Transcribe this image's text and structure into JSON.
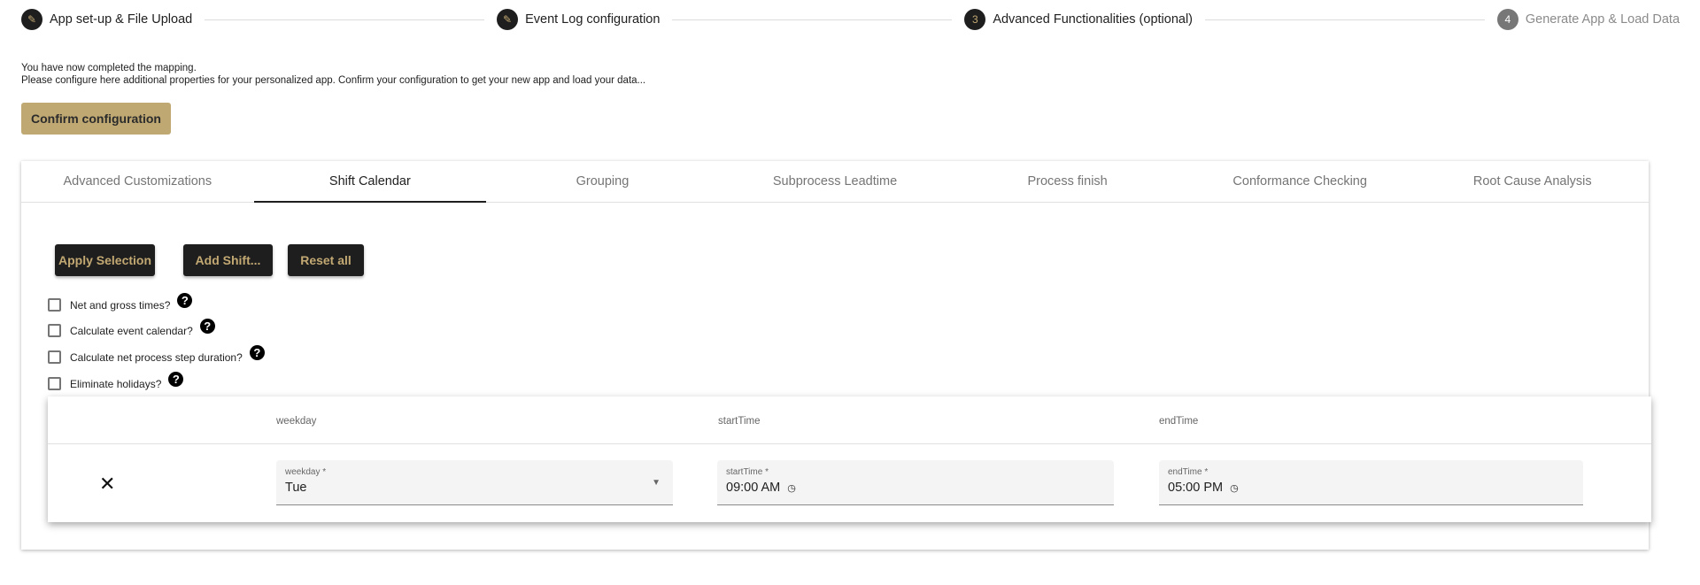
{
  "stepper": {
    "steps": [
      {
        "label": "App set-up & File Upload",
        "icon": "pencil-icon"
      },
      {
        "label": "Event Log configuration",
        "icon": "pencil-icon"
      },
      {
        "number": "3",
        "label": "Advanced Functionalities (optional)"
      },
      {
        "number": "4",
        "label": "Generate App & Load Data"
      }
    ]
  },
  "intro": {
    "line1": "You have now completed the mapping.",
    "line2": "Please configure here additional properties for your personalized app. Confirm your configuration to get your new app and load your data..."
  },
  "confirm_label": "Confirm configuration",
  "tabs": [
    "Advanced Customizations",
    "Shift Calendar",
    "Grouping",
    "Subprocess Leadtime",
    "Process finish",
    "Conformance Checking",
    "Root Cause Analysis"
  ],
  "active_tab": "Shift Calendar",
  "actions": {
    "apply": "Apply Selection",
    "add_shift": "Add Shift...",
    "reset": "Reset all"
  },
  "options": [
    {
      "label": "Net and gross times?",
      "checked": false
    },
    {
      "label": "Calculate event calendar?",
      "checked": false
    },
    {
      "label": "Calculate net process step duration?",
      "checked": false
    },
    {
      "label": "Eliminate holidays?",
      "checked": false
    }
  ],
  "help_glyph": "?",
  "table": {
    "headers": [
      "weekday",
      "startTime",
      "endTime"
    ],
    "rows": [
      {
        "delete": "✕",
        "weekday_label": "weekday *",
        "weekday": "Tue",
        "start_label": "startTime *",
        "start": "09:00 AM",
        "end_label": "endTime *",
        "end": "05:00 PM"
      }
    ]
  },
  "colors": {
    "accent": "#bfa872",
    "dark": "#1e1e1e"
  }
}
